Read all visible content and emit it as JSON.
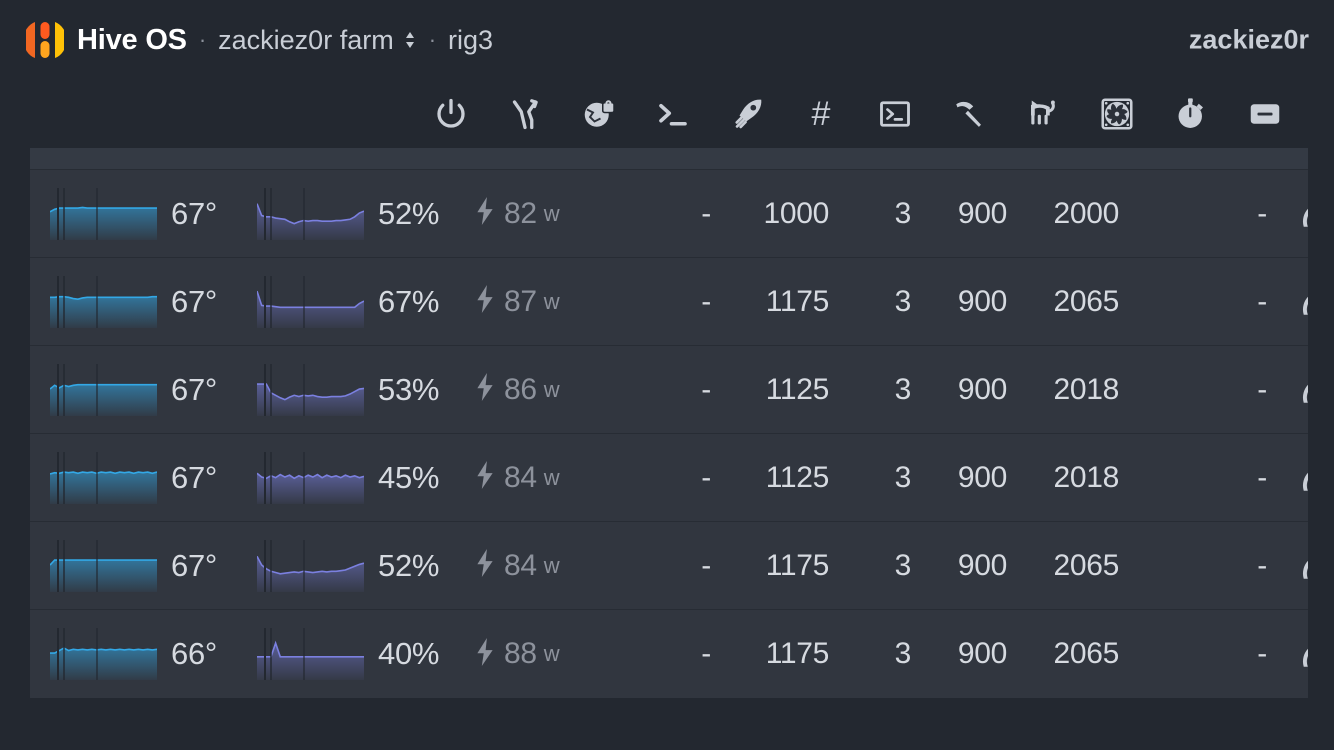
{
  "header": {
    "brand": "Hive OS",
    "separator": "·",
    "farm": "zackiez0r farm",
    "rig": "rig3",
    "user": "zackiez0r",
    "logo_colors": {
      "left": "#f26722",
      "middle_top": "#ff5a1f",
      "middle_bottom": "#ffa51f",
      "right": "#ffc107"
    }
  },
  "toolbar": {
    "buttons": [
      {
        "name": "power-icon",
        "label": "Power"
      },
      {
        "name": "shuffle-icon",
        "label": "Switch"
      },
      {
        "name": "globe-lock-icon",
        "label": "VPN"
      },
      {
        "name": "terminal-prompt-icon",
        "label": "Run command"
      },
      {
        "name": "rocket-icon",
        "label": "Boost"
      },
      {
        "name": "hashtag-icon",
        "label": "Tags"
      },
      {
        "name": "console-box-icon",
        "label": "Console"
      },
      {
        "name": "pickaxe-icon",
        "label": "Miner"
      },
      {
        "name": "watchdog-icon",
        "label": "Watchdog"
      },
      {
        "name": "fan-icon",
        "label": "Fans"
      },
      {
        "name": "stopwatch-icon",
        "label": "Benchmark"
      },
      {
        "name": "minus-box-icon",
        "label": "Collapse"
      }
    ]
  },
  "table": {
    "columns": [
      "temp_chart",
      "temp",
      "load_chart",
      "load",
      "power",
      "dash1",
      "fan",
      "pwm",
      "mem",
      "core",
      "dash2",
      "gauge"
    ],
    "rows": [
      {
        "temp": "67°",
        "load": "52%",
        "power": "82",
        "power_unit": "w",
        "dash1": "-",
        "fan": "1000",
        "pwm": "3",
        "mem": "900",
        "core": "2000",
        "dash2": "-"
      },
      {
        "temp": "67°",
        "load": "67%",
        "power": "87",
        "power_unit": "w",
        "dash1": "-",
        "fan": "1175",
        "pwm": "3",
        "mem": "900",
        "core": "2065",
        "dash2": "-"
      },
      {
        "temp": "67°",
        "load": "53%",
        "power": "86",
        "power_unit": "w",
        "dash1": "-",
        "fan": "1125",
        "pwm": "3",
        "mem": "900",
        "core": "2018",
        "dash2": "-"
      },
      {
        "temp": "67°",
        "load": "45%",
        "power": "84",
        "power_unit": "w",
        "dash1": "-",
        "fan": "1125",
        "pwm": "3",
        "mem": "900",
        "core": "2018",
        "dash2": "-"
      },
      {
        "temp": "67°",
        "load": "52%",
        "power": "84",
        "power_unit": "w",
        "dash1": "-",
        "fan": "1175",
        "pwm": "3",
        "mem": "900",
        "core": "2065",
        "dash2": "-"
      },
      {
        "temp": "66°",
        "load": "40%",
        "power": "88",
        "power_unit": "w",
        "dash1": "-",
        "fan": "1175",
        "pwm": "3",
        "mem": "900",
        "core": "2065",
        "dash2": "-"
      }
    ]
  },
  "colors": {
    "page_bg": "#232830",
    "row_bg": "#31363f",
    "row_divider": "#272c34",
    "text_primary": "#d6dae0",
    "text_muted": "#8d929c",
    "temp_line": "#33a8e6",
    "load_line": "#7b80e0"
  },
  "chart_data": {
    "type": "line",
    "title": "",
    "xlabel": "",
    "ylabel": "",
    "sparklines": [
      {
        "row": 1,
        "temp_series": {
          "name": "GPU temperature",
          "color": "#33a8e6",
          "values": [
            82,
            86,
            88,
            88,
            88,
            88,
            88,
            89,
            88,
            88,
            88,
            88,
            88,
            88,
            88,
            88,
            88,
            88,
            88,
            88,
            88,
            88,
            88,
            88
          ]
        },
        "load_series": {
          "name": "GPU load",
          "color": "#7b80e0",
          "values": [
            95,
            76,
            74,
            74,
            72,
            71,
            70,
            66,
            63,
            66,
            68,
            67,
            68,
            68,
            67,
            67,
            67,
            68,
            68,
            69,
            70,
            74,
            80,
            83
          ]
        }
      },
      {
        "row": 2,
        "temp_series": {
          "name": "GPU temperature",
          "color": "#33a8e6",
          "values": [
            86,
            86,
            87,
            87,
            86,
            84,
            83,
            85,
            86,
            86,
            86,
            86,
            86,
            86,
            86,
            86,
            86,
            86,
            86,
            86,
            86,
            86,
            87,
            87
          ]
        },
        "load_series": {
          "name": "GPU load",
          "color": "#7b80e0",
          "values": [
            96,
            73,
            72,
            72,
            71,
            70,
            70,
            70,
            70,
            70,
            70,
            70,
            70,
            70,
            70,
            70,
            70,
            70,
            70,
            70,
            70,
            70,
            76,
            80
          ]
        }
      },
      {
        "row": 3,
        "temp_series": {
          "name": "GPU temperature",
          "color": "#33a8e6",
          "values": [
            80,
            86,
            82,
            86,
            84,
            86,
            87,
            87,
            87,
            87,
            87,
            87,
            87,
            87,
            87,
            87,
            87,
            87,
            87,
            87,
            87,
            87,
            87,
            87
          ]
        },
        "load_series": {
          "name": "GPU load",
          "color": "#7b80e0",
          "values": [
            88,
            88,
            88,
            74,
            70,
            66,
            63,
            67,
            70,
            68,
            70,
            69,
            70,
            68,
            67,
            67,
            68,
            68,
            68,
            69,
            72,
            76,
            80,
            81
          ]
        }
      },
      {
        "row": 4,
        "temp_series": {
          "name": "GPU temperature",
          "color": "#33a8e6",
          "values": [
            85,
            87,
            86,
            88,
            87,
            88,
            86,
            88,
            87,
            88,
            86,
            88,
            87,
            88,
            86,
            88,
            87,
            88,
            86,
            88,
            87,
            88,
            86,
            88
          ]
        },
        "load_series": {
          "name": "GPU load",
          "color": "#7b80e0",
          "values": [
            86,
            80,
            78,
            82,
            79,
            84,
            80,
            83,
            78,
            82,
            79,
            83,
            80,
            84,
            79,
            83,
            80,
            82,
            79,
            83,
            80,
            82,
            79,
            81
          ]
        }
      },
      {
        "row": 5,
        "temp_series": {
          "name": "GPU temperature",
          "color": "#33a8e6",
          "values": [
            80,
            88,
            88,
            88,
            88,
            88,
            88,
            88,
            88,
            88,
            88,
            88,
            88,
            88,
            88,
            88,
            88,
            88,
            88,
            88,
            88,
            88,
            88,
            88
          ]
        },
        "load_series": {
          "name": "GPU load",
          "color": "#7b80e0",
          "values": [
            94,
            80,
            74,
            70,
            68,
            66,
            67,
            68,
            69,
            68,
            70,
            69,
            68,
            69,
            70,
            69,
            70,
            70,
            71,
            72,
            75,
            78,
            81,
            83
          ]
        }
      },
      {
        "row": 6,
        "temp_series": {
          "name": "GPU temperature",
          "color": "#33a8e6",
          "values": [
            80,
            80,
            84,
            88,
            84,
            86,
            85,
            86,
            85,
            86,
            85,
            86,
            85,
            86,
            85,
            86,
            85,
            86,
            85,
            86,
            85,
            86,
            85,
            86
          ]
        },
        "load_series": {
          "name": "GPU load",
          "color": "#7b80e0",
          "values": [
            74,
            74,
            74,
            74,
            96,
            74,
            74,
            74,
            74,
            74,
            74,
            74,
            74,
            74,
            74,
            74,
            74,
            74,
            74,
            74,
            74,
            74,
            74,
            74
          ]
        }
      }
    ]
  }
}
